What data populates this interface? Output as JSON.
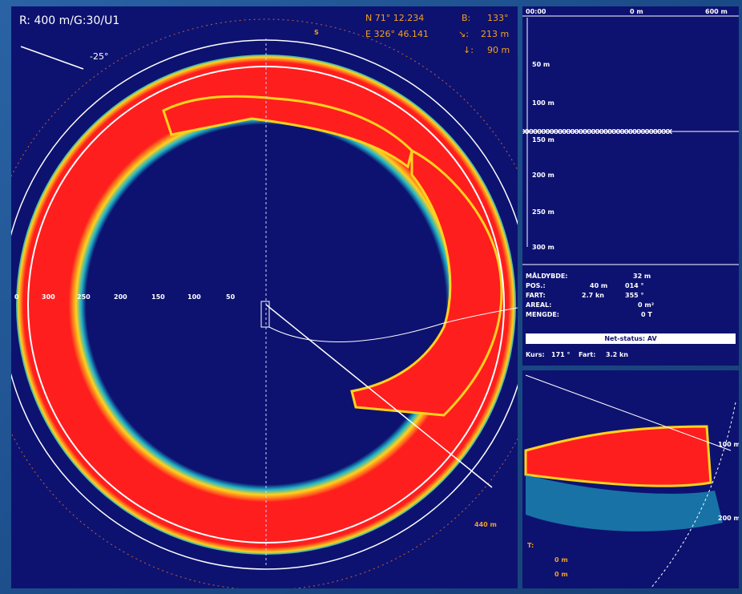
{
  "colors": {
    "background": "#0d1270",
    "echo_strong": "#ff1e1e",
    "echo_mid": "#ffd21e",
    "echo_weak": "#1fb3c9",
    "text_orange": "#f3a020",
    "text_white": "#ffffff"
  },
  "sonar": {
    "range_label": "R:  400 m/G:30/U1",
    "tilt_label": "-25°",
    "pos_n": "N  71° 12.234",
    "pos_e": "E  326° 46.141",
    "bearing_label": "B:",
    "bearing_value": "133°",
    "slant_icon": "slant-range-icon",
    "slant_value": "213 m",
    "depth_icon": "depth-arrow-icon",
    "depth_value": "90 m",
    "north_marker": "S",
    "range_ticks": [
      "0",
      "300",
      "250",
      "200",
      "150",
      "100",
      "50"
    ],
    "range_cursor": "440 m"
  },
  "echo": {
    "time": "00:00",
    "x_labels": [
      "0 m",
      "600 m"
    ],
    "depth_labels": [
      "50 m",
      "100 m",
      "150 m",
      "200 m",
      "250 m",
      "300 m"
    ],
    "x_marker_row": "XXXXXXXXXXXXXXXXXXXXXXXXXXXXXXXXXXXX",
    "info": {
      "maldybde_label": "MÅLDYBDE:",
      "maldybde_value": "32 m",
      "pos_label": "POS.:",
      "pos_dist": "40 m",
      "pos_bearing": "014 °",
      "fart_label": "FART:",
      "fart_speed": "2.7 kn",
      "fart_bearing": "355 °",
      "areal_label": "AREAL:",
      "areal_value": "0 m²",
      "mengde_label": "MENGDE:",
      "mengde_value": "0 T"
    },
    "net_status": "Net-status: AV",
    "kurs_label": "Kurs:",
    "kurs_value": "171 °",
    "fart2_label": "Fart:",
    "fart2_value": "3.2 kn"
  },
  "vertical": {
    "range_labels": [
      "100 m",
      "200 m"
    ],
    "readouts": [
      "T:",
      "0 m",
      "0 m"
    ]
  }
}
